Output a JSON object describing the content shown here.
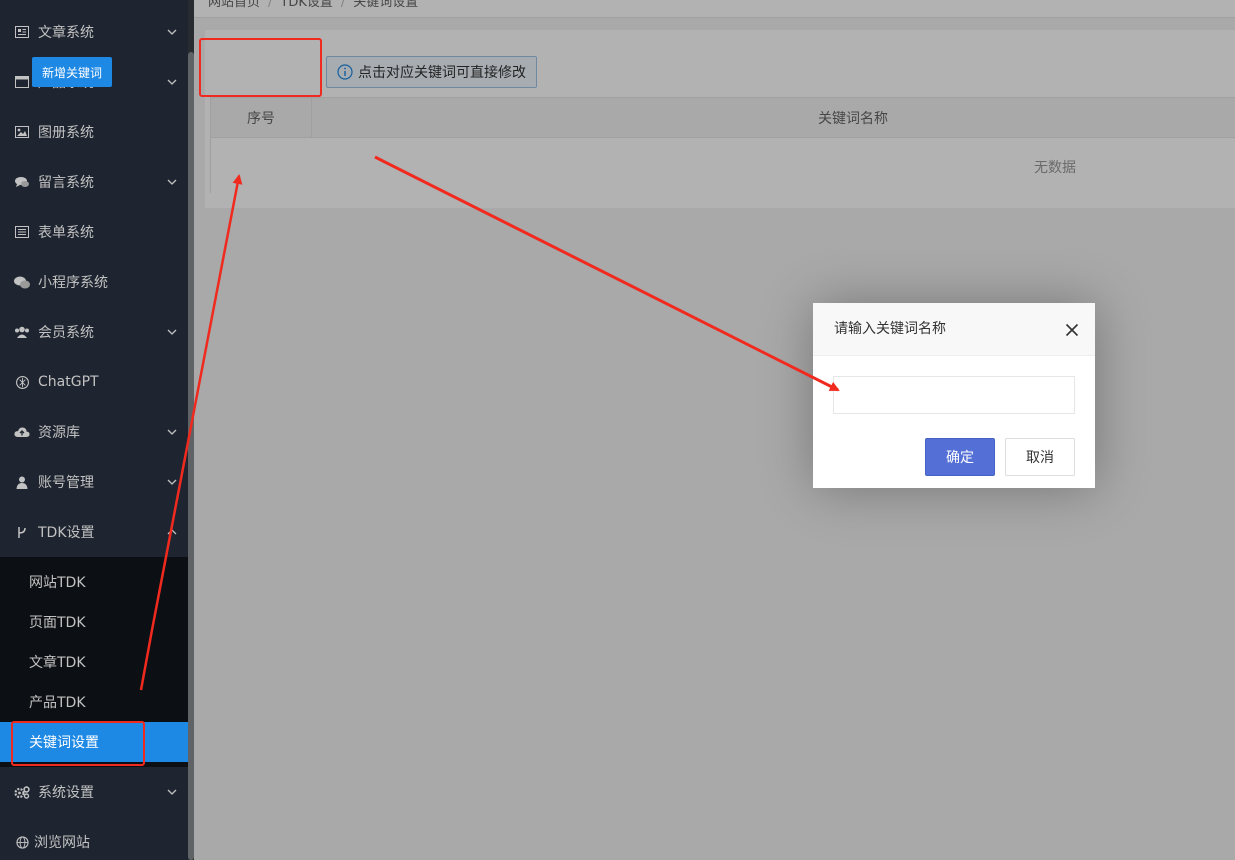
{
  "sidebar": {
    "items": [
      {
        "label": "文章系统",
        "icon": "newspaper-icon",
        "chevron": "down"
      },
      {
        "label": "产品系统",
        "icon": "window-icon",
        "chevron": "down"
      },
      {
        "label": "图册系统",
        "icon": "image-icon",
        "chevron": ""
      },
      {
        "label": "留言系统",
        "icon": "comments-icon",
        "chevron": "down"
      },
      {
        "label": "表单系统",
        "icon": "list-icon",
        "chevron": ""
      },
      {
        "label": "小程序系统",
        "icon": "wechat-icon",
        "chevron": ""
      },
      {
        "label": "会员系统",
        "icon": "users-icon",
        "chevron": "down"
      },
      {
        "label": "ChatGPT",
        "icon": "openai-icon",
        "chevron": ""
      },
      {
        "label": "资源库",
        "icon": "cloud-upload-icon",
        "chevron": "down"
      },
      {
        "label": "账号管理",
        "icon": "user-icon",
        "chevron": "down"
      },
      {
        "label": "TDK设置",
        "icon": "branch-icon",
        "chevron": "up"
      },
      {
        "label": "系统设置",
        "icon": "gears-icon",
        "chevron": "down"
      },
      {
        "label": "浏览网站",
        "icon": "globe-icon",
        "chevron": ""
      }
    ],
    "submenu": [
      {
        "label": "网站TDK"
      },
      {
        "label": "页面TDK"
      },
      {
        "label": "文章TDK"
      },
      {
        "label": "产品TDK"
      },
      {
        "label": "关键词设置",
        "active": true
      }
    ]
  },
  "breadcrumb": [
    "网站首页",
    "TDK设置",
    "关键词设置"
  ],
  "breadcrumb_sep": "/",
  "toolbar": {
    "add_label": "新增关键词",
    "tip": "点击对应关键词可直接修改"
  },
  "table": {
    "columns": [
      "序号",
      "关键词名称"
    ],
    "empty_text": "无数据"
  },
  "dialog": {
    "title": "请输入关键词名称",
    "input_value": "",
    "ok_label": "确定",
    "cancel_label": "取消"
  },
  "colors": {
    "sidebar_bg": "#1e2530",
    "active": "#1e88e5",
    "annotation": "#f02a1e",
    "ok_button": "#5470d6"
  }
}
